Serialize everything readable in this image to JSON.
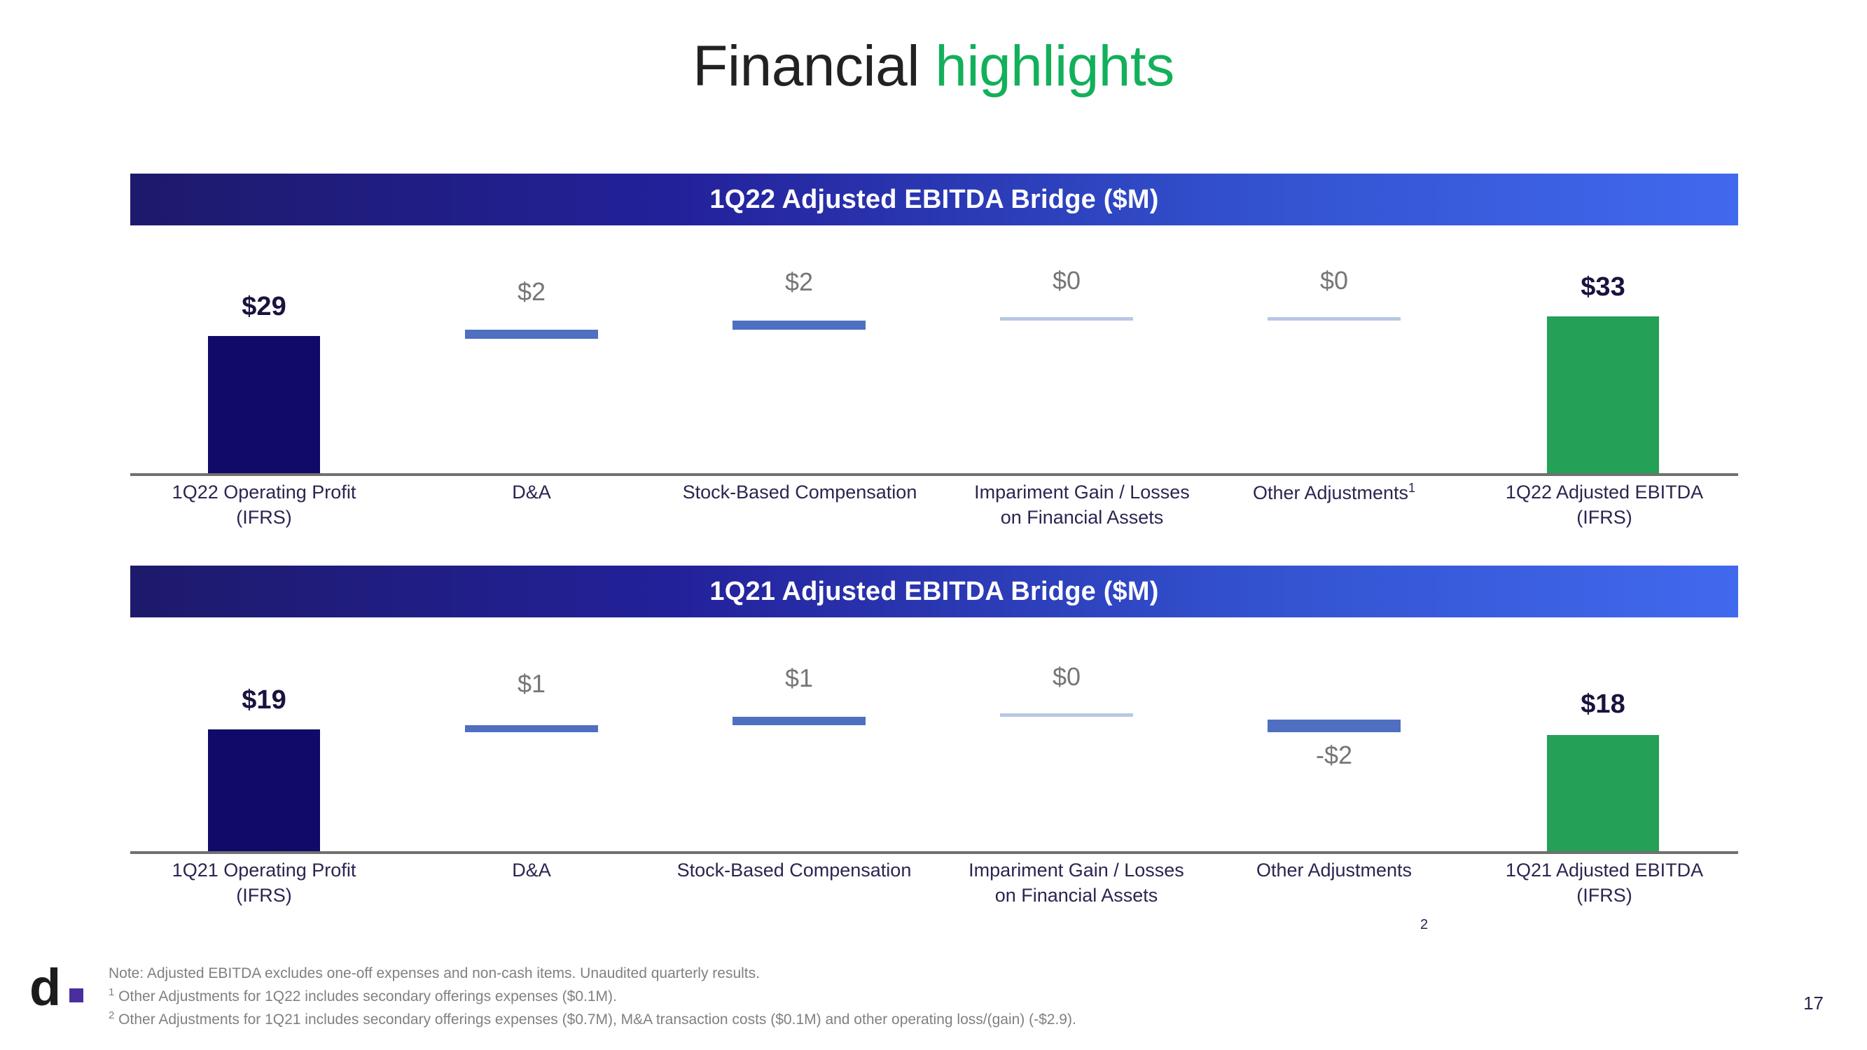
{
  "title": {
    "main": "Financial ",
    "accent": "highlights"
  },
  "colors": {
    "navy": "#110a68",
    "green": "#25a057",
    "connector_blue": "#4f6fc0",
    "connector_faint": "#b9c7e4",
    "banner_gradient_start": "#1d1a6b",
    "banner_gradient_end": "#4169ee",
    "accent_green": "#12b05a",
    "axis": "#707070",
    "label_gray": "#767676",
    "label_navy": "#2b2550"
  },
  "charts": [
    {
      "banner": "1Q22 Adjusted EBITDA Bridge ($M)",
      "categories": [
        "1Q22 Operating Profit\n(IFRS)",
        "D&A",
        "Stock-Based Compensation",
        "Impariment Gain / Losses\non Financial Assets",
        "Other Adjustments",
        "1Q22 Adjusted EBITDA\n(IFRS)"
      ],
      "cat_superscripts": [
        "",
        "",
        "",
        "",
        "1",
        ""
      ],
      "values": [
        29,
        2,
        2,
        0,
        0,
        33
      ],
      "labels": [
        "$29",
        "$2",
        "$2",
        "$0",
        "$0",
        "$33"
      ]
    },
    {
      "banner": "1Q21 Adjusted EBITDA Bridge ($M)",
      "categories": [
        "1Q21 Operating Profit\n(IFRS)",
        "D&A",
        "Stock-Based Compensation",
        "Impariment Gain / Losses\non Financial Assets",
        "Other Adjustments",
        "1Q21 Adjusted EBITDA\n(IFRS)"
      ],
      "cat_superscripts": [
        "",
        "",
        "",
        "",
        "",
        ""
      ],
      "standalone_superscript": "2",
      "values": [
        19,
        1,
        1,
        0,
        -2,
        18
      ],
      "labels": [
        "$19",
        "$1",
        "$1",
        "$0",
        "-$2",
        "$18"
      ]
    }
  ],
  "chart_data": [
    {
      "type": "bar",
      "title": "1Q22 Adjusted EBITDA Bridge ($M)",
      "subtype": "waterfall",
      "categories": [
        "1Q22 Operating Profit (IFRS)",
        "D&A",
        "Stock-Based Compensation",
        "Impariment Gain / Losses on Financial Assets",
        "Other Adjustments",
        "1Q22 Adjusted EBITDA (IFRS)"
      ],
      "values": [
        29,
        2,
        2,
        0,
        0,
        33
      ],
      "data_labels": [
        "$29",
        "$2",
        "$2",
        "$0",
        "$0",
        "$33"
      ],
      "bar_kinds": [
        "total",
        "delta",
        "delta",
        "delta",
        "delta",
        "total"
      ],
      "cumulative_base": [
        0,
        29,
        31,
        33,
        33,
        0
      ],
      "cumulative_top": [
        29,
        31,
        33,
        33,
        33,
        33
      ],
      "xlabel": "",
      "ylabel": "$M",
      "ylim": [
        0,
        36
      ],
      "grid": false,
      "legend": "none",
      "footnote_markers": {
        "Other Adjustments": "1"
      }
    },
    {
      "type": "bar",
      "title": "1Q21 Adjusted EBITDA Bridge ($M)",
      "subtype": "waterfall",
      "categories": [
        "1Q21 Operating Profit (IFRS)",
        "D&A",
        "Stock-Based Compensation",
        "Impariment Gain / Losses on Financial Assets",
        "Other Adjustments",
        "1Q21 Adjusted EBITDA (IFRS)"
      ],
      "values": [
        19,
        1,
        1,
        0,
        -2,
        18
      ],
      "data_labels": [
        "$19",
        "$1",
        "$1",
        "$0",
        "-$2",
        "$18"
      ],
      "bar_kinds": [
        "total",
        "delta",
        "delta",
        "delta",
        "delta",
        "total"
      ],
      "cumulative_base": [
        0,
        19,
        20,
        21,
        19,
        0
      ],
      "cumulative_top": [
        19,
        20,
        21,
        21,
        21,
        18
      ],
      "xlabel": "",
      "ylabel": "$M",
      "ylim": [
        0,
        24
      ],
      "grid": false,
      "legend": "none",
      "footnote_markers": {
        "Other Adjustments": "2"
      }
    }
  ],
  "footnotes": {
    "note": "Note: Adjusted EBITDA excludes one-off expenses and non-cash items. Unaudited quarterly results.",
    "fn1_marker": "1",
    "fn1": " Other Adjustments for 1Q22 includes secondary offerings expenses ($0.1M).",
    "fn2_marker": "2",
    "fn2": " Other Adjustments for 1Q21 includes secondary offerings expenses ($0.7M), M&A transaction costs ($0.1M) and other operating loss/(gain) (-$2.9)."
  },
  "logo": {
    "letter": "d"
  },
  "page_number": "17"
}
